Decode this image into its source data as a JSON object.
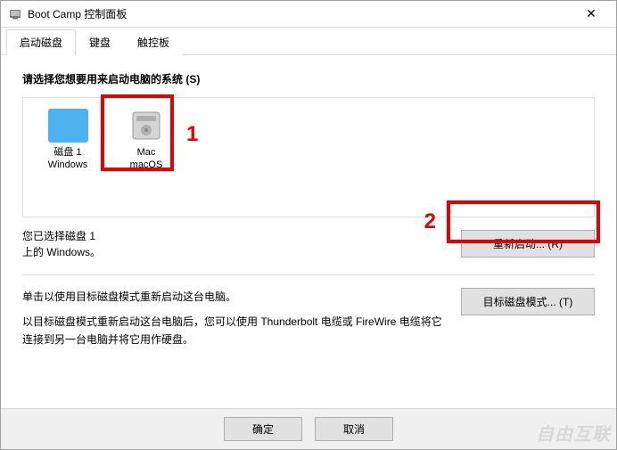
{
  "window": {
    "title": "Boot Camp 控制面板"
  },
  "tabs": {
    "startup": "启动磁盘",
    "keyboard": "键盘",
    "trackpad": "触控板"
  },
  "main": {
    "section_title": "请选择您想要用来启动电脑的系统 (S)",
    "disks": [
      {
        "label": "磁盘 1\nWindows"
      },
      {
        "label": "Mac\nmacOS"
      }
    ],
    "selected_text": "您已选择磁盘 1\n上的 Windows。",
    "restart_btn": "重新启动... (R)",
    "target_title": "单击以使用目标磁盘模式重新启动这台电脑。",
    "target_desc": "以目标磁盘模式重新启动这台电脑后，您可以使用 Thunderbolt 电缆或 FireWire 电缆将它连接到另一台电脑并将它用作硬盘。",
    "target_btn": "目标磁盘模式... (T)"
  },
  "annotations": {
    "one": "1",
    "two": "2"
  },
  "footer": {
    "ok": "确定",
    "cancel": "取消"
  },
  "watermark": "自由互联"
}
